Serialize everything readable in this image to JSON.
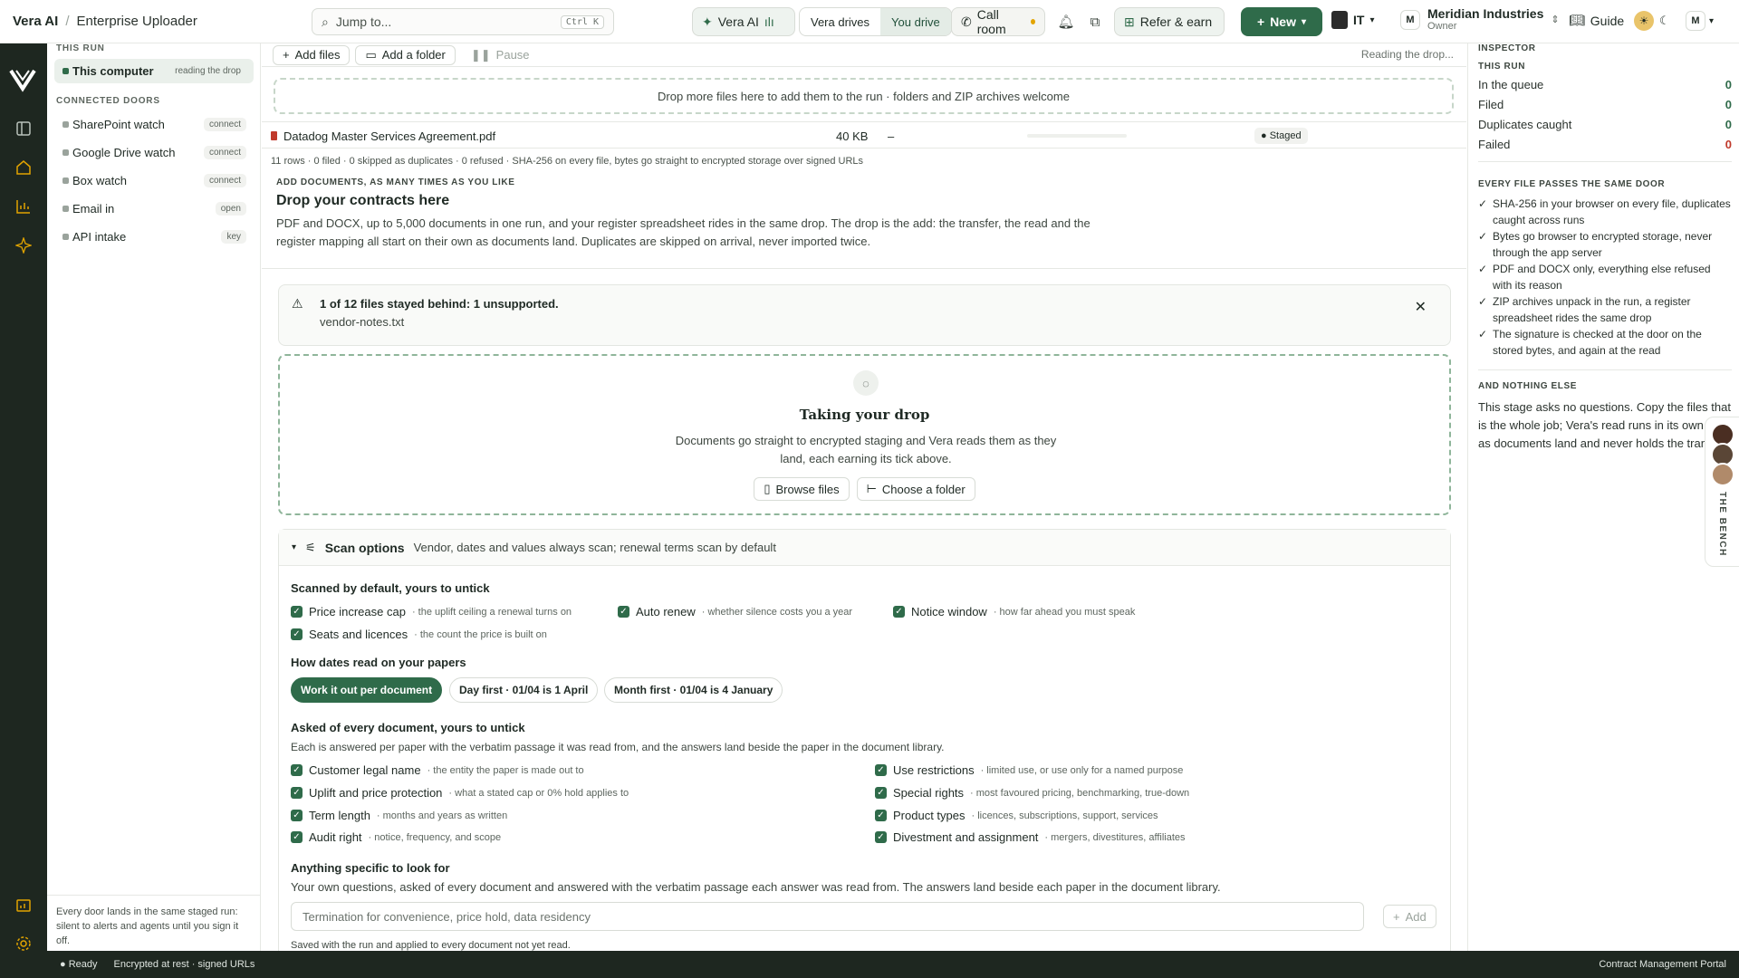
{
  "topbar": {
    "app": "Vera AI",
    "sep": "/",
    "page": "Enterprise Uploader",
    "jump_placeholder": "Jump to...",
    "jump_kbd": "Ctrl K",
    "vera_ai": "Vera AI",
    "seg_vera": "Vera drives",
    "seg_you": "You drive",
    "call_room": "Call room",
    "refer": "Refer & earn",
    "new": "New",
    "it": "IT",
    "org_initial": "M",
    "org_name": "Meridian Industries",
    "org_role": "Owner",
    "guide": "Guide",
    "user_initial": "M"
  },
  "sidebar": {
    "run_heading": "THIS RUN",
    "this_computer": {
      "label": "This computer",
      "tag": "reading the drop"
    },
    "doors_heading": "CONNECTED DOORS",
    "doors": [
      {
        "label": "SharePoint watch",
        "tag": "connect"
      },
      {
        "label": "Google Drive watch",
        "tag": "connect"
      },
      {
        "label": "Box watch",
        "tag": "connect"
      },
      {
        "label": "Email in",
        "tag": "open"
      },
      {
        "label": "API intake",
        "tag": "key"
      }
    ],
    "footer": "Every door lands in the same staged run: silent to alerts and agents until you sign it off."
  },
  "toolbar": {
    "add_files": "Add files",
    "add_folder": "Add a folder",
    "pause": "Pause",
    "status": "Reading the drop..."
  },
  "drop_strip": "Drop more files here to add them to the run · folders and ZIP archives welcome",
  "file": {
    "name": "Datadog Master Services Agreement.pdf",
    "size": "40 KB",
    "dash": "–",
    "status": "Staged"
  },
  "summary": "11 rows · 0 filed · 0 skipped as duplicates · 0 refused · SHA-256 on every file, bytes go straight to encrypted storage over signed URLs",
  "intro": {
    "eyebrow": "ADD DOCUMENTS, AS MANY TIMES AS YOU LIKE",
    "title": "Drop your contracts here",
    "body": "PDF and DOCX, up to 5,000 documents in one run, and your register spreadsheet rides in the same drop. The drop is the add: the transfer, the read and the register mapping all start on their own as documents land. Duplicates are skipped on arrival, never imported twice."
  },
  "alert": {
    "title": "1 of 12 files stayed behind: 1 unsupported.",
    "file": "vendor-notes.txt"
  },
  "dropzone": {
    "title": "Taking your drop",
    "body": "Documents go straight to encrypted staging and Vera reads them as they land, each earning its tick above.",
    "browse": "Browse files",
    "folder": "Choose a folder"
  },
  "scan": {
    "title": "Scan options",
    "subtitle": "Vendor, dates and values always scan; renewal terms scan by default",
    "default_heading": "Scanned by default, yours to untick",
    "defaults": [
      {
        "label": "Price increase cap",
        "hint": "· the uplift ceiling a renewal turns on"
      },
      {
        "label": "Auto renew",
        "hint": "· whether silence costs you a year"
      },
      {
        "label": "Notice window",
        "hint": "· how far ahead you must speak"
      },
      {
        "label": "Seats and licences",
        "hint": "· the count the price is built on"
      }
    ],
    "dates_heading": "How dates read on your papers",
    "date_options": [
      {
        "label": "Work it out per document",
        "selected": true
      },
      {
        "label": "Day first · 01/04 is 1 April",
        "selected": false
      },
      {
        "label": "Month first · 01/04 is 4 January",
        "selected": false
      }
    ],
    "asked_heading": "Asked of every document, yours to untick",
    "asked_desc": "Each is answered per paper with the verbatim passage it was read from, and the answers land beside the paper in the document library.",
    "asked": [
      {
        "label": "Customer legal name",
        "hint": "· the entity the paper is made out to"
      },
      {
        "label": "Uplift and price protection",
        "hint": "· what a stated cap or 0% hold applies to"
      },
      {
        "label": "Term length",
        "hint": "· months and years as written"
      },
      {
        "label": "Audit right",
        "hint": "· notice, frequency, and scope"
      },
      {
        "label": "Use restrictions",
        "hint": "· limited use, or use only for a named purpose"
      },
      {
        "label": "Special rights",
        "hint": "· most favoured pricing, benchmarking, true-down"
      },
      {
        "label": "Product types",
        "hint": "· licences, subscriptions, support, services"
      },
      {
        "label": "Divestment and assignment",
        "hint": "· mergers, divestitures, affiliates"
      }
    ],
    "specific_heading": "Anything specific to look for",
    "specific_desc": "Your own questions, asked of every document and answered with the verbatim passage each answer was read from. The answers land beside each paper in the document library.",
    "specific_placeholder": "Termination for convenience, price hold, data residency",
    "add": "Add",
    "saved_note": "Saved with the run and applied to every document not yet read."
  },
  "inspector": {
    "title": "INSPECTOR",
    "run_heading": "THIS RUN",
    "stats": [
      {
        "label": "In the queue",
        "value": "0"
      },
      {
        "label": "Filed",
        "value": "0"
      },
      {
        "label": "Duplicates caught",
        "value": "0"
      },
      {
        "label": "Failed",
        "value": "0"
      }
    ],
    "door_heading": "EVERY FILE PASSES THE SAME DOOR",
    "checks": [
      "SHA-256 in your browser on every file, duplicates caught across runs",
      "Bytes go browser to encrypted storage, never through the app server",
      "PDF and DOCX only, everything else refused with its reason",
      "ZIP archives unpack in the run, a register spreadsheet rides the same drop",
      "The signature is checked at the door on the stored bytes, and again at the read"
    ],
    "else_heading": "AND NOTHING ELSE",
    "else_body": "This stage asks no questions. Copy the files that is the whole job; Vera's read runs in its own lane as documents land and never holds the transfer."
  },
  "bench": {
    "label": "THE BENCH"
  },
  "statusbar": {
    "ready": "Ready",
    "enc": "Encrypted at rest · signed URLs",
    "right": "Contract Management Portal"
  },
  "colors": {
    "accent": "#2f6b4a",
    "rail": "#1e2720",
    "danger": "#c0392b"
  }
}
